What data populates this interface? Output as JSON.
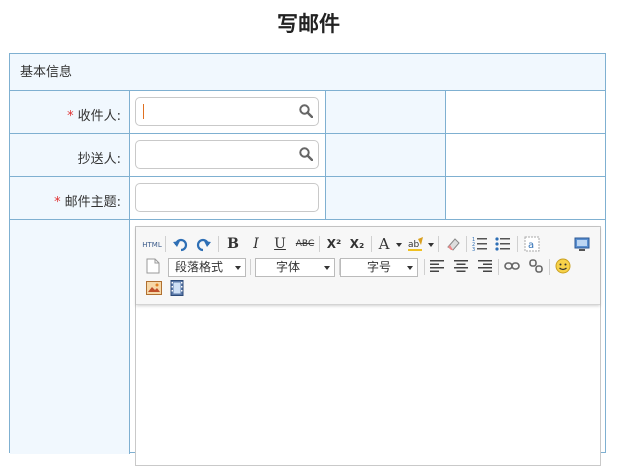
{
  "page": {
    "title": "写邮件"
  },
  "section": {
    "title": "基本信息"
  },
  "fields": {
    "to": {
      "required": "*",
      "label": "收件人:"
    },
    "cc": {
      "label": "抄送人:"
    },
    "subject": {
      "required": "*",
      "label": "邮件主题:"
    }
  },
  "editor": {
    "html_label": "HTML",
    "bold": "B",
    "italic": "I",
    "underline": "U",
    "strike": "ABC",
    "superscript": "X²",
    "subscript": "X₂",
    "font_color": "A",
    "paragraph_format": "段落格式",
    "font_family": "字体",
    "font_size": "字号"
  },
  "colors": {
    "border": "#7fb0d1",
    "label_bg": "#f1f8fe",
    "required": "#e03030"
  }
}
